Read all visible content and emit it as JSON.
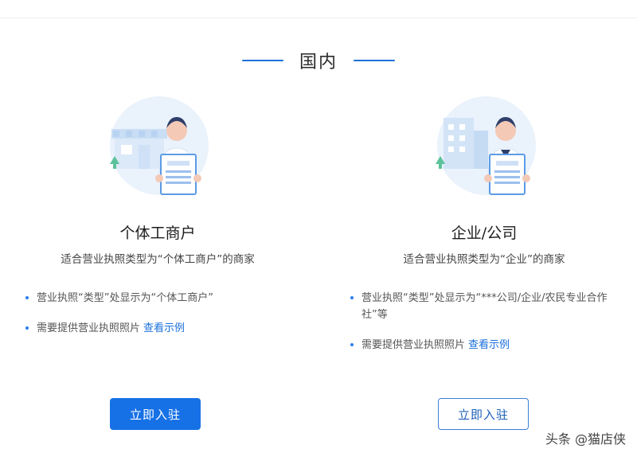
{
  "section": {
    "title": "国内"
  },
  "cards": [
    {
      "title": "个体工商户",
      "subtitle": "适合营业执照类型为“个体工商户”的商家",
      "bullets": [
        {
          "text": "营业执照“类型”处显示为“个体工商户”"
        },
        {
          "text": "需要提供营业执照照片",
          "link": "查看示例"
        }
      ],
      "button": "立即入驻",
      "illustration_label": "营业执照"
    },
    {
      "title": "企业/公司",
      "subtitle": "适合营业执照类型为“企业”的商家",
      "bullets": [
        {
          "text": "营业执照“类型”处显示为“***公司/企业/农民专业合作社”等"
        },
        {
          "text": "需要提供营业执照照片",
          "link": "查看示例"
        }
      ],
      "button": "立即入驻",
      "illustration_label": "营业执照"
    }
  ],
  "watermark": "头条 @猫店侠",
  "colors": {
    "accent": "#1771e6",
    "link": "#1a6fdc",
    "header_line": "#1e6fd9"
  }
}
